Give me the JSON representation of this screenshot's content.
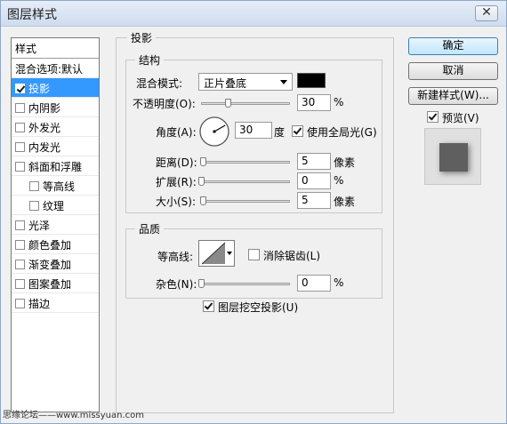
{
  "window": {
    "title": "图层样式",
    "close": "✕"
  },
  "styles_list": {
    "header": "样式",
    "items": [
      {
        "label": "混合选项:默认",
        "checkbox": false,
        "checked": false,
        "selected": false,
        "indent": false
      },
      {
        "label": "投影",
        "checkbox": true,
        "checked": true,
        "selected": true,
        "indent": false
      },
      {
        "label": "内阴影",
        "checkbox": true,
        "checked": false,
        "selected": false,
        "indent": false
      },
      {
        "label": "外发光",
        "checkbox": true,
        "checked": false,
        "selected": false,
        "indent": false
      },
      {
        "label": "内发光",
        "checkbox": true,
        "checked": false,
        "selected": false,
        "indent": false
      },
      {
        "label": "斜面和浮雕",
        "checkbox": true,
        "checked": false,
        "selected": false,
        "indent": false
      },
      {
        "label": "等高线",
        "checkbox": true,
        "checked": false,
        "selected": false,
        "indent": true
      },
      {
        "label": "纹理",
        "checkbox": true,
        "checked": false,
        "selected": false,
        "indent": true
      },
      {
        "label": "光泽",
        "checkbox": true,
        "checked": false,
        "selected": false,
        "indent": false
      },
      {
        "label": "颜色叠加",
        "checkbox": true,
        "checked": false,
        "selected": false,
        "indent": false
      },
      {
        "label": "渐变叠加",
        "checkbox": true,
        "checked": false,
        "selected": false,
        "indent": false
      },
      {
        "label": "图案叠加",
        "checkbox": true,
        "checked": false,
        "selected": false,
        "indent": false
      },
      {
        "label": "描边",
        "checkbox": true,
        "checked": false,
        "selected": false,
        "indent": false
      }
    ]
  },
  "drop_shadow": {
    "title": "投影",
    "structure": {
      "title": "结构",
      "blend_mode_label": "混合模式:",
      "blend_mode_value": "正片叠底",
      "shadow_color": "#000000",
      "opacity_label": "不透明度(O):",
      "opacity_value": "30",
      "opacity_percent": 30,
      "opacity_unit": "%",
      "angle_label": "角度(A):",
      "angle_value": "30",
      "angle_degrees": 30,
      "angle_unit": "度",
      "global_light_label": "使用全局光(G)",
      "global_light_checked": true,
      "distance_label": "距离(D):",
      "distance_value": "5",
      "distance_fraction": 0.02,
      "distance_unit": "像素",
      "spread_label": "扩展(R):",
      "spread_value": "0",
      "spread_fraction": 0,
      "spread_unit": "%",
      "size_label": "大小(S):",
      "size_value": "5",
      "size_fraction": 0.02,
      "size_unit": "像素"
    },
    "quality": {
      "title": "品质",
      "contour_label": "等高线:",
      "anti_alias_label": "消除锯齿(L)",
      "anti_alias_checked": false,
      "noise_label": "杂色(N):",
      "noise_value": "0",
      "noise_fraction": 0,
      "noise_unit": "%"
    },
    "knockout_label": "图层挖空投影(U)",
    "knockout_checked": true
  },
  "buttons": {
    "ok": "确定",
    "cancel": "取消",
    "new_style": "新建样式(W)...",
    "preview_label": "预览(V)",
    "preview_checked": true
  },
  "watermark": "思缘论坛——www.missyuan.com"
}
